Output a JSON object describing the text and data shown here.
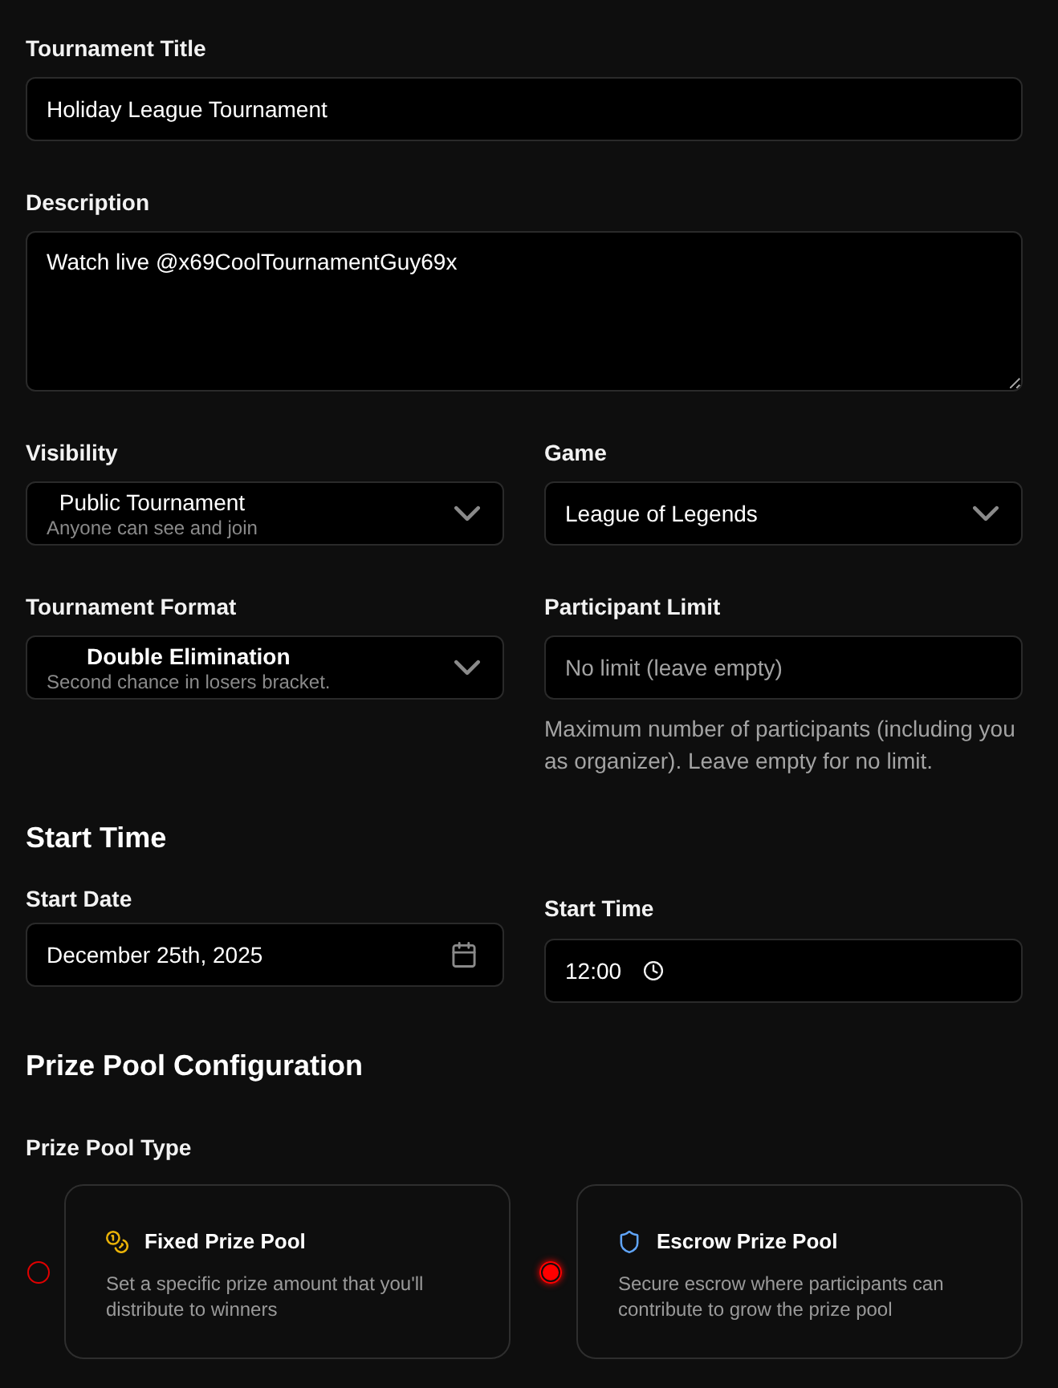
{
  "title_field": {
    "label": "Tournament Title",
    "value": "Holiday League Tournament"
  },
  "description_field": {
    "label": "Description",
    "value": "Watch live @x69CoolTournamentGuy69x"
  },
  "visibility": {
    "label": "Visibility",
    "value": "Public Tournament",
    "hint": "Anyone can see and join"
  },
  "game": {
    "label": "Game",
    "value": "League of Legends"
  },
  "format": {
    "label": "Tournament Format",
    "value": "Double Elimination",
    "hint": "Second chance in losers bracket."
  },
  "participant_limit": {
    "label": "Participant Limit",
    "placeholder": "No limit (leave empty)",
    "help": "Maximum number of participants (including you as organizer). Leave empty for no limit."
  },
  "start_time_section": {
    "heading": "Start Time",
    "date": {
      "label": "Start Date",
      "value": "December 25th, 2025"
    },
    "time": {
      "label": "Start Time",
      "value": "12:00"
    }
  },
  "prize_pool": {
    "heading": "Prize Pool Configuration",
    "type_label": "Prize Pool Type",
    "options": [
      {
        "kind": "fixed",
        "title": "Fixed Prize Pool",
        "description": "Set a specific prize amount that you'll distribute to winners",
        "selected": false
      },
      {
        "kind": "escrow",
        "title": "Escrow Prize Pool",
        "description": "Secure escrow where participants can contribute to grow the prize pool",
        "selected": true
      }
    ]
  }
}
